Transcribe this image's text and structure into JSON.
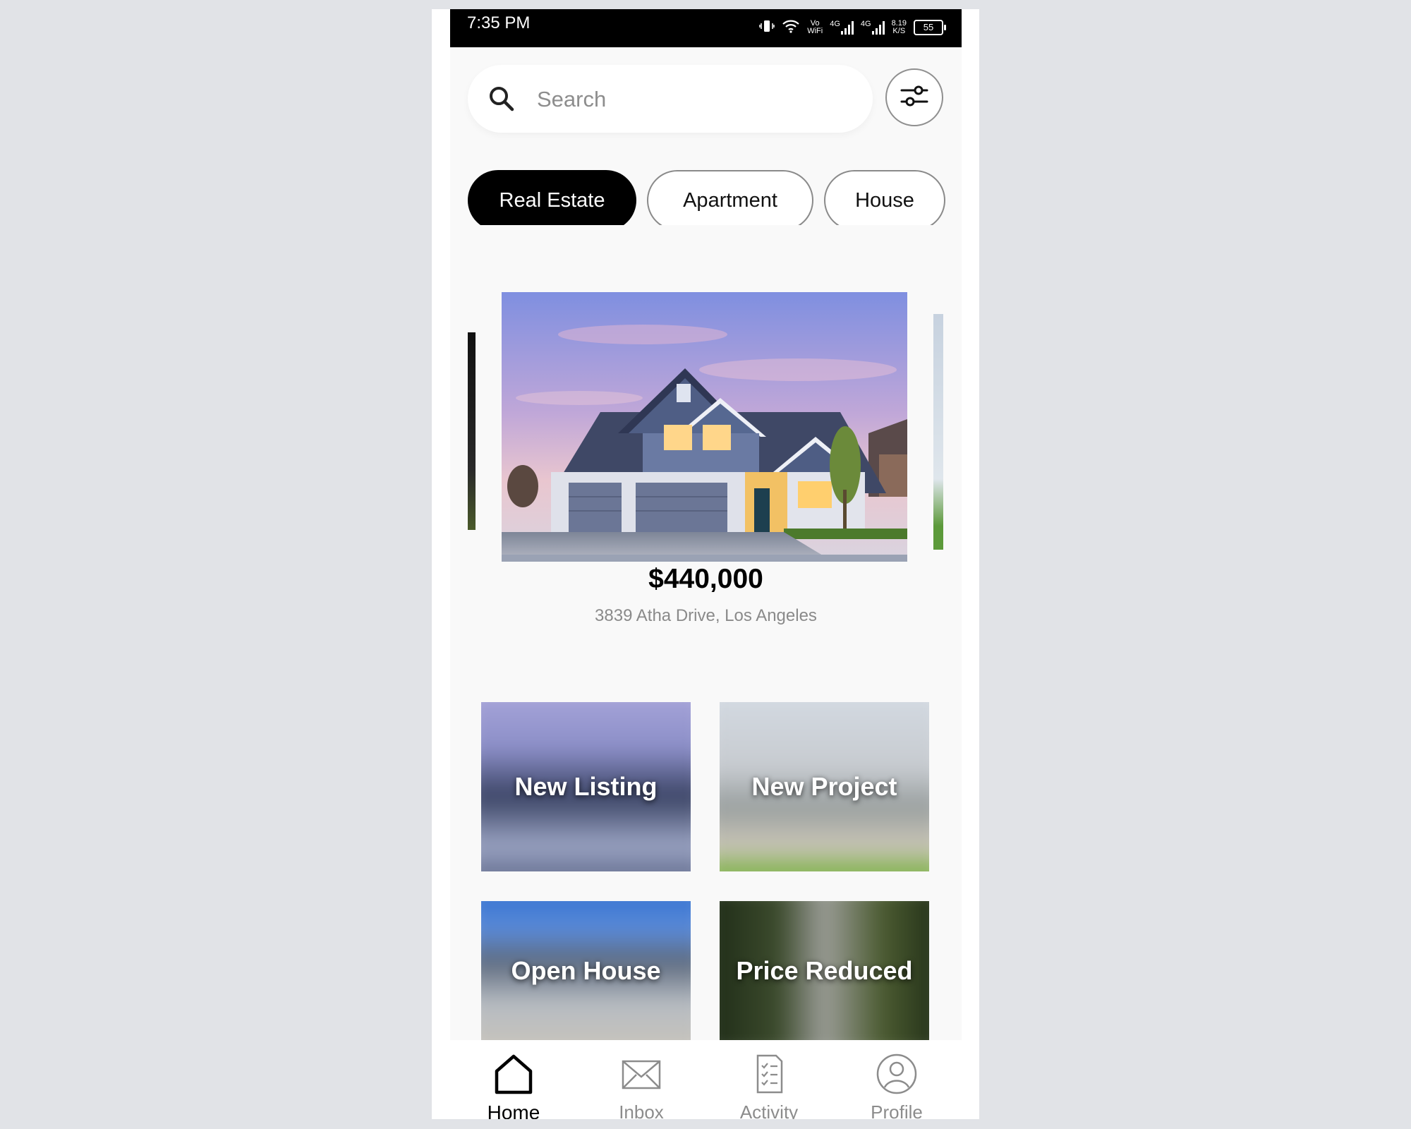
{
  "status_bar": {
    "time": "7:35 PM",
    "vo_wifi_top": "Vo",
    "vo_wifi_bottom": "WiFi",
    "net1": "4G",
    "net2": "4G",
    "speed_top": "8.19",
    "speed_bottom": "K/S",
    "battery": "55"
  },
  "search": {
    "placeholder": "Search"
  },
  "chips": [
    {
      "label": "Real Estate",
      "active": true
    },
    {
      "label": "Apartment",
      "active": false
    },
    {
      "label": "House",
      "active": false
    }
  ],
  "featured": {
    "price": "$440,000",
    "address": "3839 Atha Drive, Los Angeles"
  },
  "categories": [
    {
      "label": "New Listing"
    },
    {
      "label": "New Project"
    },
    {
      "label": "Open House"
    },
    {
      "label": "Price Reduced"
    }
  ],
  "bottom_nav": [
    {
      "label": "Home",
      "icon": "home-icon",
      "active": true
    },
    {
      "label": "Inbox",
      "icon": "mail-icon",
      "active": false
    },
    {
      "label": "Activity",
      "icon": "clipboard-checklist-icon",
      "active": false
    },
    {
      "label": "Profile",
      "icon": "user-icon",
      "active": false
    }
  ],
  "colors": {
    "accent": "#000000",
    "background": "#f9f9f9",
    "muted_text": "#8a8a8a"
  }
}
